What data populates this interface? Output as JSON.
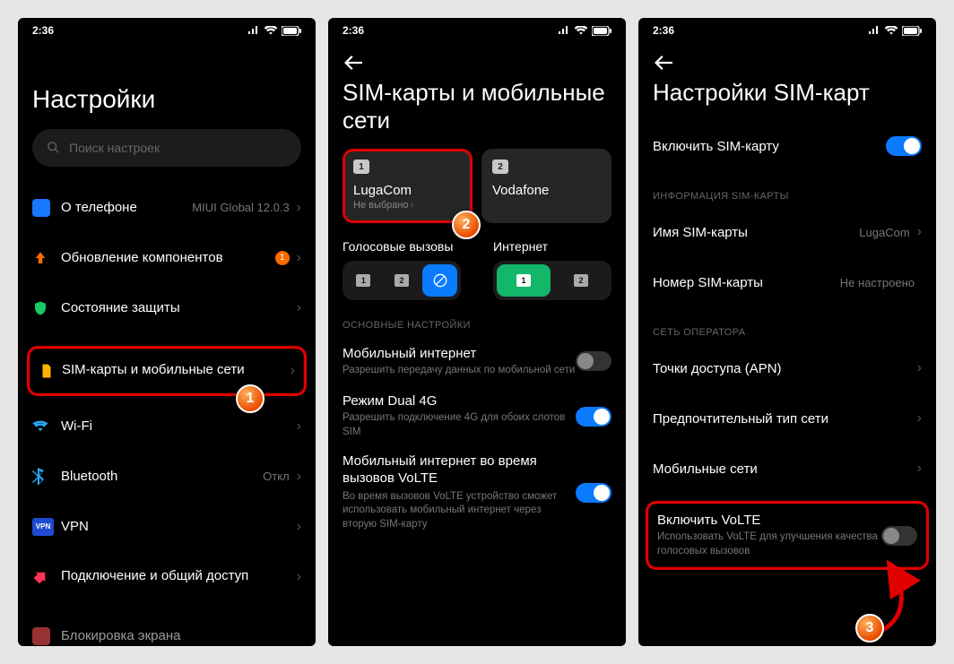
{
  "status": {
    "time": "2:36"
  },
  "screen1": {
    "title": "Настройки",
    "search_placeholder": "Поиск настроек",
    "items": {
      "about": {
        "label": "О телефоне",
        "value": "MIUI Global 12.0.3"
      },
      "updates": {
        "label": "Обновление компонентов",
        "badge": "1"
      },
      "security": {
        "label": "Состояние защиты"
      },
      "sim": {
        "label": "SIM-карты и мобильные сети"
      },
      "wifi": {
        "label": "Wi-Fi"
      },
      "bluetooth": {
        "label": "Bluetooth",
        "value": "Откл"
      },
      "vpn": {
        "label": "VPN"
      },
      "hotspot": {
        "label": "Подключение и общий доступ"
      },
      "lockscreen": {
        "label": "Блокировка экрана"
      }
    },
    "marker": "1"
  },
  "screen2": {
    "title": "SIM-карты и мобильные сети",
    "sim1": {
      "num": "1",
      "name": "LugaCom",
      "sub": "Не выбрано"
    },
    "sim2": {
      "num": "2",
      "name": "Vodafone"
    },
    "voice_label": "Голосовые вызовы",
    "internet_label": "Интернет",
    "voice_opts": {
      "a": "1",
      "b": "2"
    },
    "net_opts": {
      "a": "1",
      "b": "2"
    },
    "section_main": "ОСНОВНЫЕ НАСТРОЙКИ",
    "mobile_data": {
      "label": "Мобильный интернет",
      "sub": "Разрешить передачу данных по мобильной сети"
    },
    "dual4g": {
      "label": "Режим Dual 4G",
      "sub": "Разрешить подключение 4G для обоих слотов SIM"
    },
    "volte_calls": {
      "label": "Мобильный интернет во время вызовов VoLTE",
      "sub": "Во время вызовов VoLTE устройство сможет использовать мобильный интернет через вторую SIM-карту"
    },
    "marker": "2"
  },
  "screen3": {
    "title": "Настройки SIM-карт",
    "enable_sim": {
      "label": "Включить SIM-карту"
    },
    "section_info": "ИНФОРМАЦИЯ SIM-КАРТЫ",
    "sim_name": {
      "label": "Имя SIM-карты",
      "value": "LugaCom"
    },
    "sim_number": {
      "label": "Номер SIM-карты",
      "value": "Не настроено"
    },
    "section_net": "СЕТЬ ОПЕРАТОРА",
    "apn": {
      "label": "Точки доступа (APN)"
    },
    "pref_net": {
      "label": "Предпочтительный тип сети"
    },
    "mobile_net": {
      "label": "Мобильные сети"
    },
    "volte": {
      "label": "Включить VoLTE",
      "sub": "Использовать VoLTE для улучшения качества голосовых вызовов"
    },
    "marker": "3"
  }
}
